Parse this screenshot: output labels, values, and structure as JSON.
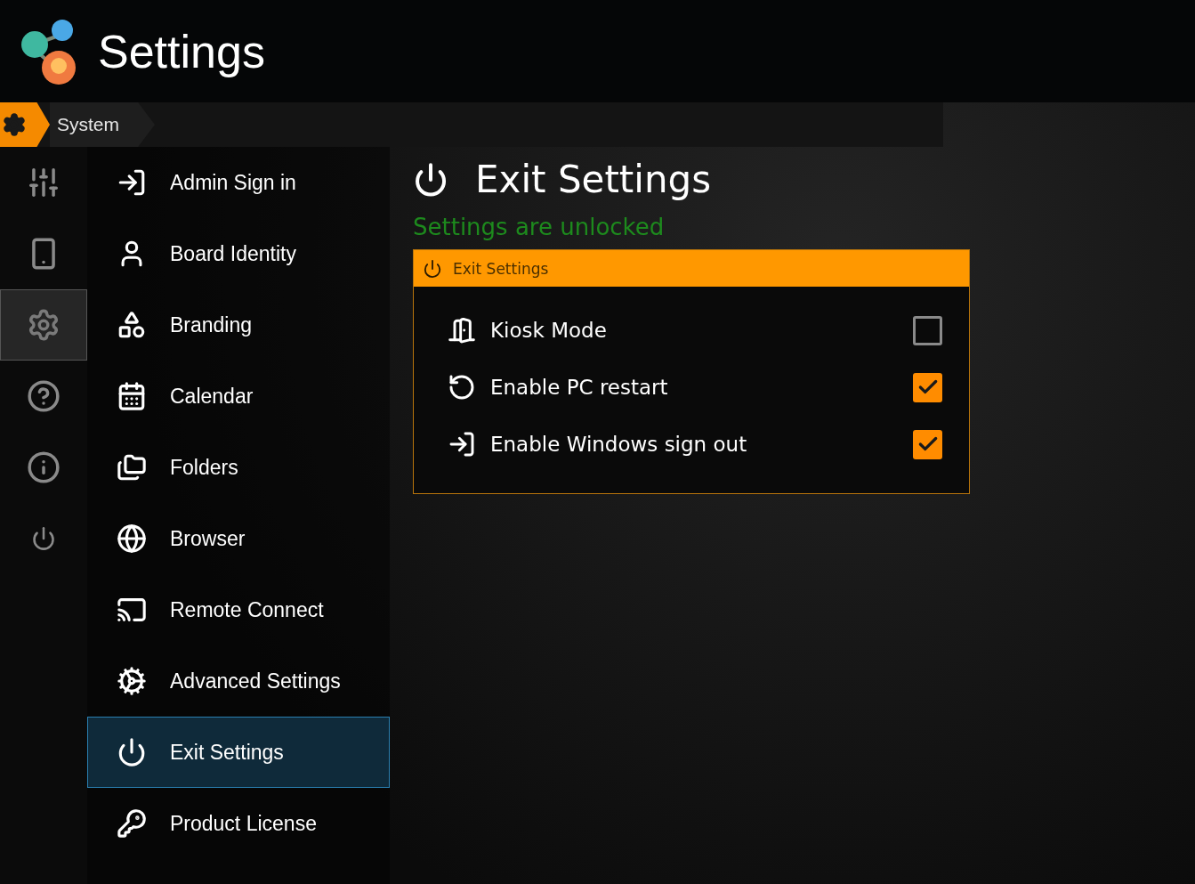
{
  "app": {
    "title": "Settings"
  },
  "breadcrumb": {
    "label": "System"
  },
  "rail": [
    {
      "kind": "sliders",
      "selected": false
    },
    {
      "kind": "device",
      "selected": false
    },
    {
      "kind": "gear",
      "selected": true
    },
    {
      "kind": "help",
      "selected": false
    },
    {
      "kind": "info",
      "selected": false
    },
    {
      "kind": "power",
      "selected": false
    }
  ],
  "nav": [
    {
      "kind": "signin",
      "label": "Admin Sign in",
      "selected": false
    },
    {
      "kind": "user",
      "label": "Board Identity",
      "selected": false
    },
    {
      "kind": "shapes",
      "label": "Branding",
      "selected": false
    },
    {
      "kind": "calendar",
      "label": "Calendar",
      "selected": false
    },
    {
      "kind": "folders",
      "label": "Folders",
      "selected": false
    },
    {
      "kind": "globe",
      "label": "Browser",
      "selected": false
    },
    {
      "kind": "cast",
      "label": "Remote Connect",
      "selected": false
    },
    {
      "kind": "cog",
      "label": "Advanced Settings",
      "selected": false
    },
    {
      "kind": "power",
      "label": "Exit Settings",
      "selected": true
    },
    {
      "kind": "key",
      "label": "Product License",
      "selected": false
    }
  ],
  "page": {
    "title": "Exit Settings",
    "status": "Settings are unlocked",
    "panel": {
      "title": "Exit Settings",
      "options": [
        {
          "kind": "kiosk",
          "label": "Kiosk Mode",
          "checked": false
        },
        {
          "kind": "restart",
          "label": "Enable PC restart",
          "checked": true
        },
        {
          "kind": "signout",
          "label": "Enable Windows sign out",
          "checked": true
        }
      ]
    }
  }
}
